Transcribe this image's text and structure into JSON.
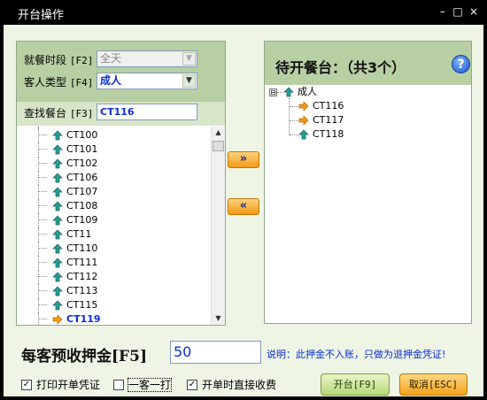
{
  "window": {
    "title": "开台操作",
    "controls": [
      "–",
      "□",
      "×"
    ]
  },
  "filters": {
    "meal_period": {
      "label": "就餐时段",
      "key": "[F2]",
      "value": "全天"
    },
    "guest_type": {
      "label": "客人类型",
      "key": "[F4]",
      "value": "成人"
    },
    "find_table": {
      "label": "查找餐台",
      "key": "[F3]",
      "value": "CT116"
    }
  },
  "table_list": {
    "items": [
      "CT100",
      "CT101",
      "CT102",
      "CT106",
      "CT107",
      "CT108",
      "CT109",
      "CT11",
      "CT110",
      "CT111",
      "CT112",
      "CT113",
      "CT115",
      "CT119"
    ],
    "selected": "CT119"
  },
  "move_buttons": {
    "add": "»",
    "remove": "«"
  },
  "pending": {
    "title": "待开餐台：（共3个）",
    "group": "成人",
    "group_expander": "⊟",
    "items": [
      "CT116",
      "CT117",
      "CT118"
    ]
  },
  "deposit": {
    "label": "每客预收押金[F5]",
    "value": "50",
    "note": "说明：此押金不入账，只做为退押金凭证!"
  },
  "options": {
    "print_voucher": {
      "label": "打印开单凭证",
      "checked": true
    },
    "one_per_guest": {
      "label": "一客一打",
      "checked": false
    },
    "charge_on_open": {
      "label": "开单时直接收费",
      "checked": true
    }
  },
  "buttons": {
    "open": "开台[F9]",
    "cancel": "取消[ESC]"
  },
  "colors": {
    "accent_blue": "#0a2dd8",
    "panel_green": "#b8cfa4",
    "orange": "#f29a14"
  }
}
